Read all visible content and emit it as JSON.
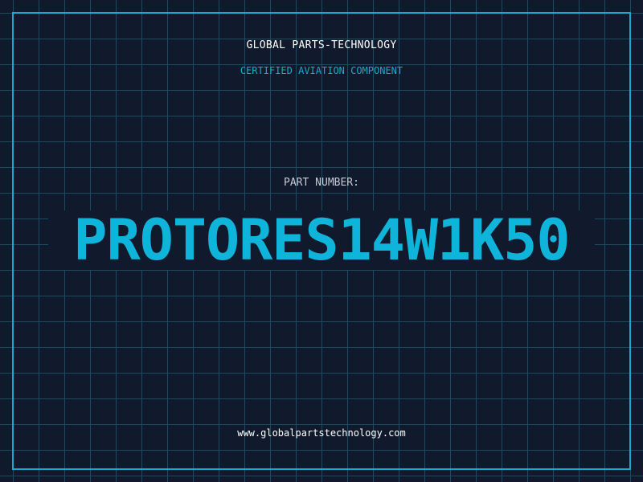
{
  "header": {
    "company": "GLOBAL PARTS-TECHNOLOGY",
    "subtitle": "CERTIFIED AVIATION COMPONENT"
  },
  "part": {
    "label": "PART NUMBER:",
    "number": "PROTORES14W1K50"
  },
  "footer": {
    "website": "www.globalpartstechnology.com"
  },
  "colors": {
    "background": "#111a2d",
    "grid": "#1f4a5c",
    "accent": "#1aa8cc",
    "part_number": "#0fb4da",
    "text": "#ffffff"
  }
}
